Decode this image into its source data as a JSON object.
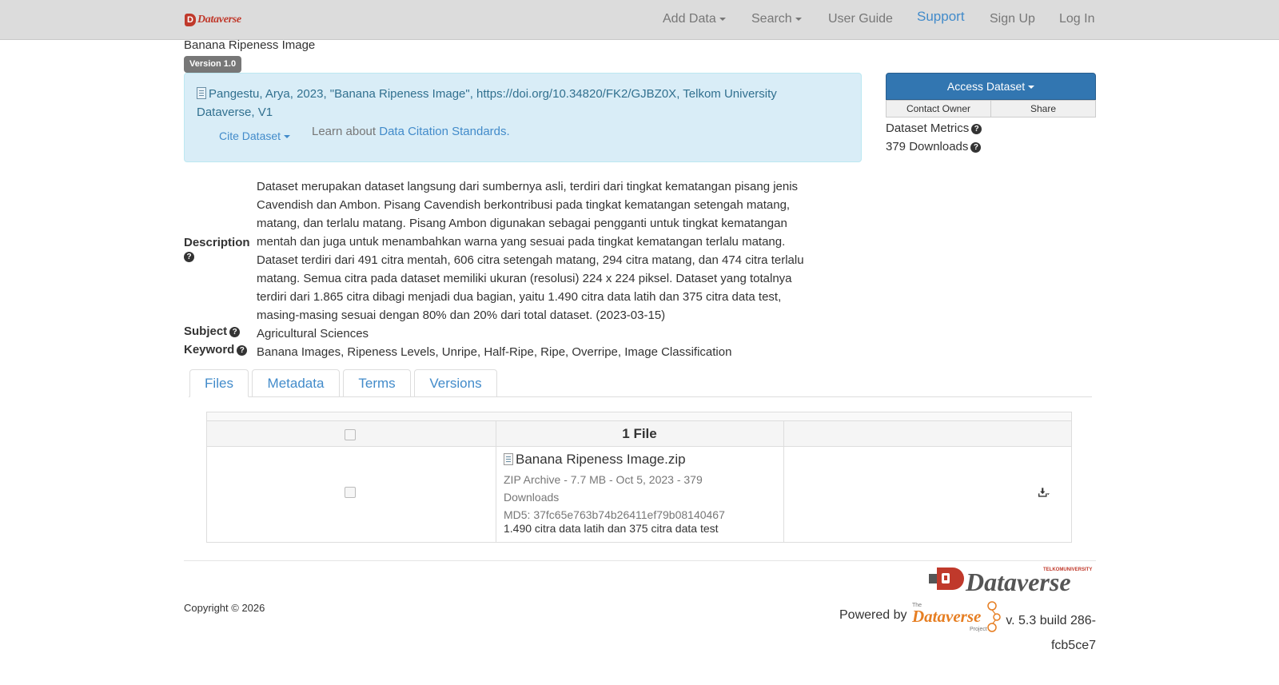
{
  "navbar": {
    "brand_text": "Dataverse",
    "items": [
      {
        "label": "Add Data",
        "dropdown": true
      },
      {
        "label": "Search",
        "dropdown": true
      },
      {
        "label": "User Guide",
        "dropdown": false
      },
      {
        "label": "Support",
        "dropdown": false
      },
      {
        "label": "Sign Up",
        "dropdown": false
      },
      {
        "label": "Log In",
        "dropdown": false
      }
    ]
  },
  "dataset": {
    "title": "Banana Ripeness Image",
    "version_badge": "Version 1.0"
  },
  "citation": {
    "text_prefix": "Pangestu, Arya, 2023, \"Banana Ripeness Image\", ",
    "doi_link": "https://doi.org/10.34820/FK2/GJBZ0X",
    "text_suffix": ", Telkom University Dataverse, V1",
    "cite_button": "Cite Dataset",
    "learn_prefix": "Learn about ",
    "learn_link": "Data Citation Standards."
  },
  "sidebar": {
    "access_button": "Access Dataset",
    "contact_owner": "Contact Owner",
    "share": "Share",
    "metrics_label": "Dataset Metrics",
    "downloads_label": "379 Downloads"
  },
  "metadata": {
    "description_label": "Description",
    "description_lines": [
      "Dataset merupakan dataset langsung dari sumbernya asli, terdiri dari tingkat kematangan pisang jenis",
      "Cavendish dan Ambon. Pisang Cavendish berkontribusi pada tingkat kematangan setengah matang,",
      "matang, dan terlalu matang. Pisang Ambon digunakan sebagai pengganti untuk tingkat kematangan",
      "mentah dan juga untuk menambahkan warna yang sesuai pada tingkat kematangan terlalu matang.",
      "Dataset terdiri dari 491 citra mentah, 606 citra setengah matang, 294 citra matang, dan 474 citra terlalu",
      "matang. Semua citra pada dataset memiliki ukuran (resolusi) 224 x 224 piksel. Dataset yang totalnya",
      "terdiri dari 1.865 citra dibagi menjadi dua bagian, yaitu 1.490 citra data latih dan 375 citra data test,",
      "masing-masing sesuai dengan 80% dan 20% dari total dataset. (2023-03-15)"
    ],
    "subject_label": "Subject",
    "subject_value": "Agricultural Sciences",
    "keyword_label": "Keyword",
    "keyword_value": "Banana Images, Ripeness Levels, Unripe, Half-Ripe, Ripe, Overripe, Image Classification"
  },
  "tabs": [
    {
      "label": "Files",
      "active": true
    },
    {
      "label": "Metadata",
      "active": false
    },
    {
      "label": "Terms",
      "active": false
    },
    {
      "label": "Versions",
      "active": false
    }
  ],
  "files": {
    "count_label": "1 File",
    "items": [
      {
        "name": "Banana Ripeness Image.zip",
        "meta": "ZIP Archive - 7.7 MB - Oct 5, 2023 - 379 Downloads",
        "md5": "MD5: 37fc65e763b74b26411ef79b08140467",
        "description": "1.490 citra data latih dan 375 citra data test"
      }
    ]
  },
  "footer": {
    "copyright": "Copyright © 2026",
    "logo_text": "Dataverse",
    "logo_small_text": "TELKOMUNIVERSITY",
    "powered_by": "Powered by",
    "project_logo_small": "The",
    "project_logo_text": "Dataverse",
    "project_logo_sub": "Project",
    "version": "v. 5.3 build 286-fcb5ce7"
  },
  "colors": {
    "link": "#428bca",
    "primary_button": "#3276b1",
    "citation_bg": "#d9edf7",
    "brand_red": "#c0392b",
    "project_orange": "#e67e22"
  }
}
